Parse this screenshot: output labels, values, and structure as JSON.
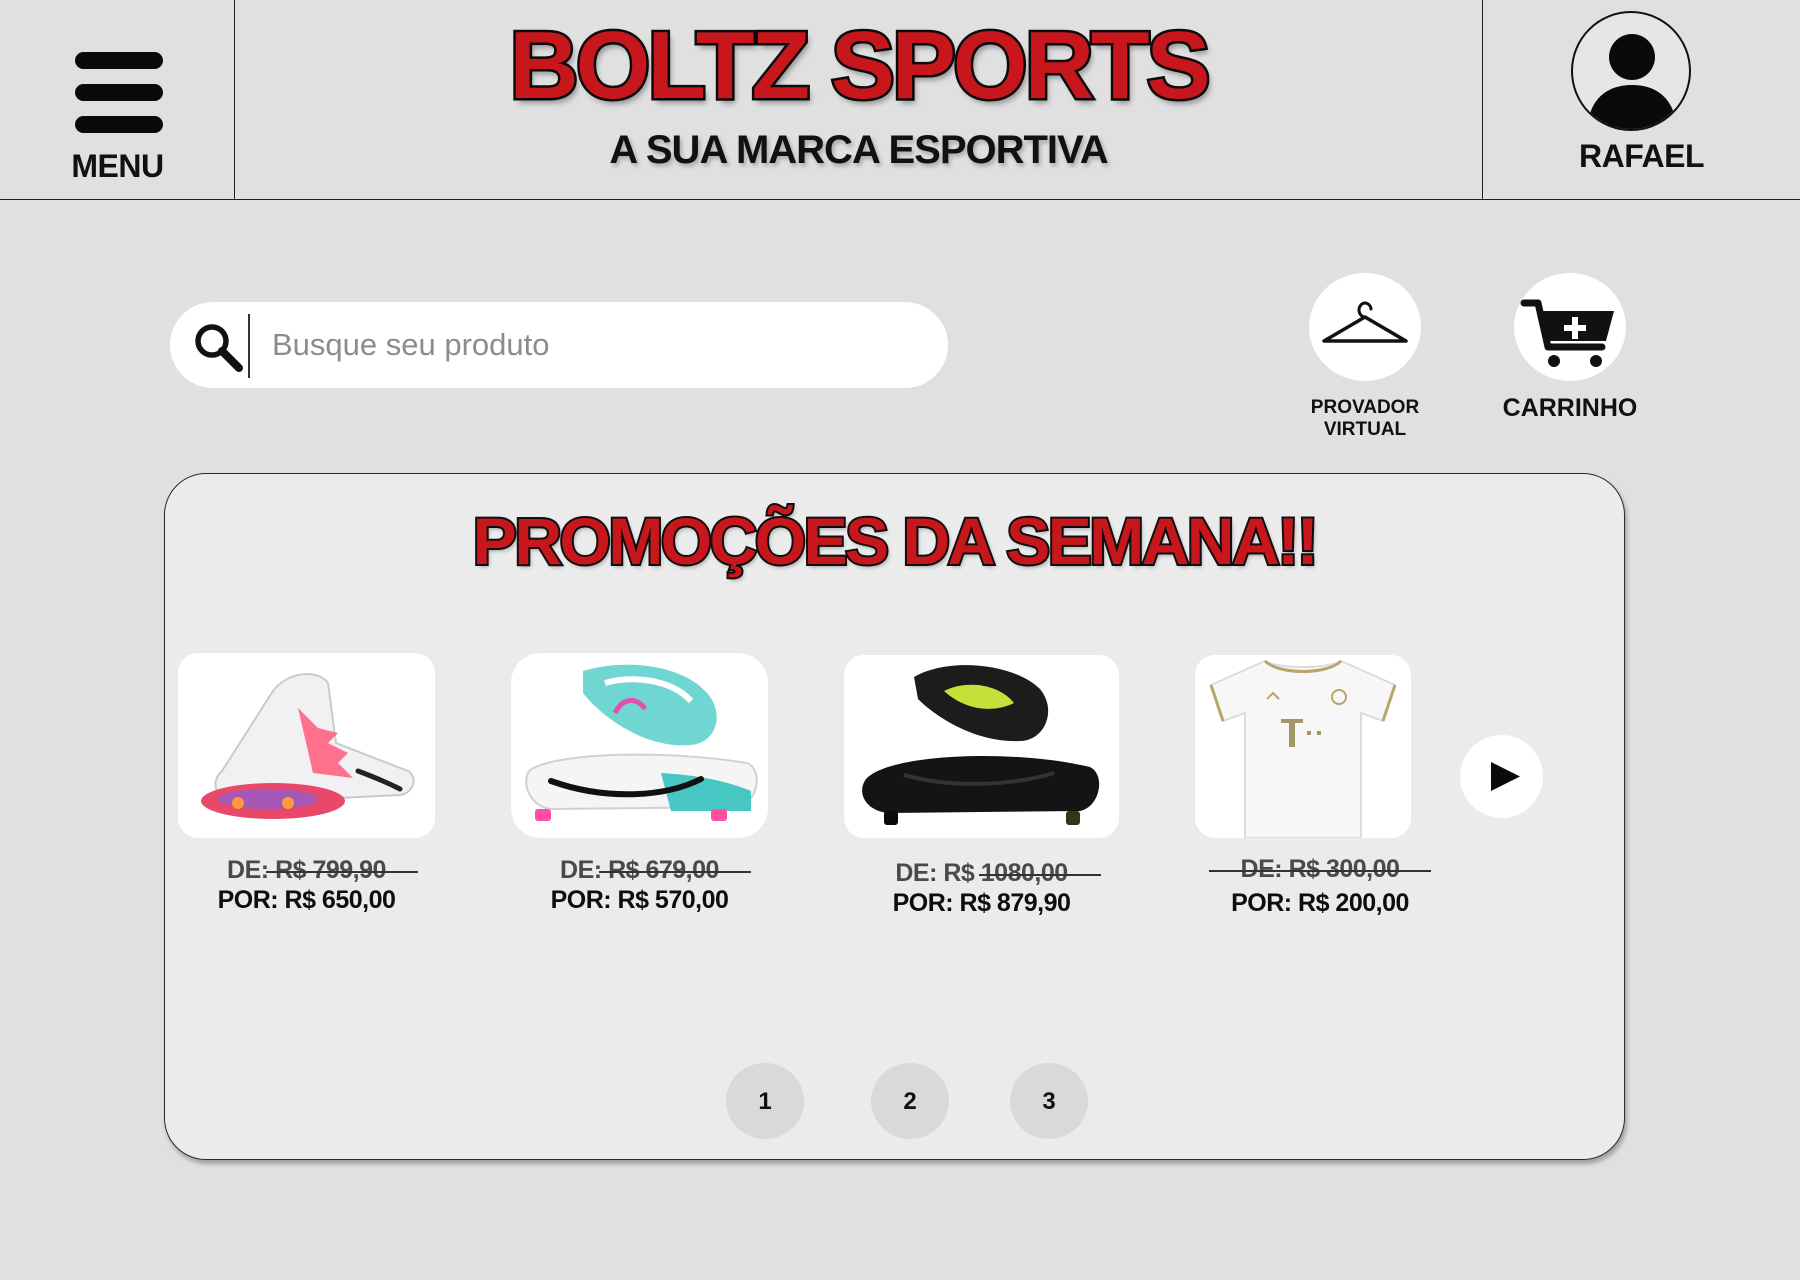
{
  "header": {
    "menu_label": "MENU",
    "brand_title": "BOLTZ SPORTS",
    "brand_subtitle": "A SUA MARCA ESPORTIVA",
    "user_name": "RAFAEL"
  },
  "search": {
    "placeholder": "Busque seu produto",
    "icon": "search-icon"
  },
  "actions": {
    "virtual_fitting_line1": "PROVADOR",
    "virtual_fitting_line2": "VIRTUAL",
    "cart_label": "CARRINHO"
  },
  "promo": {
    "title": "PROMOÇÕES DA SEMANA!!",
    "products": [
      {
        "image": "white-pink-football-boot",
        "old_prefix": "DE:",
        "old_price": "R$ 799,90",
        "new_price": "POR: R$ 650,00"
      },
      {
        "image": "white-teal-football-boot",
        "old_prefix": "DE:",
        "old_price": "R$ 679,00",
        "new_price": "POR: R$ 570,00"
      },
      {
        "image": "black-football-boot",
        "old_prefix": "DE: R$",
        "old_price": "1080,00",
        "new_price": "POR: R$ 879,90"
      },
      {
        "image": "white-football-jersey",
        "old_prefix": "DE:",
        "old_price": "R$ 300,00",
        "new_price": "POR: R$ 200,00"
      }
    ],
    "pages": [
      "1",
      "2",
      "3"
    ]
  },
  "colors": {
    "background": "#e0e0e0",
    "panel": "#ebebeb",
    "brand_red": "#c8171c",
    "outline": "#111111"
  }
}
